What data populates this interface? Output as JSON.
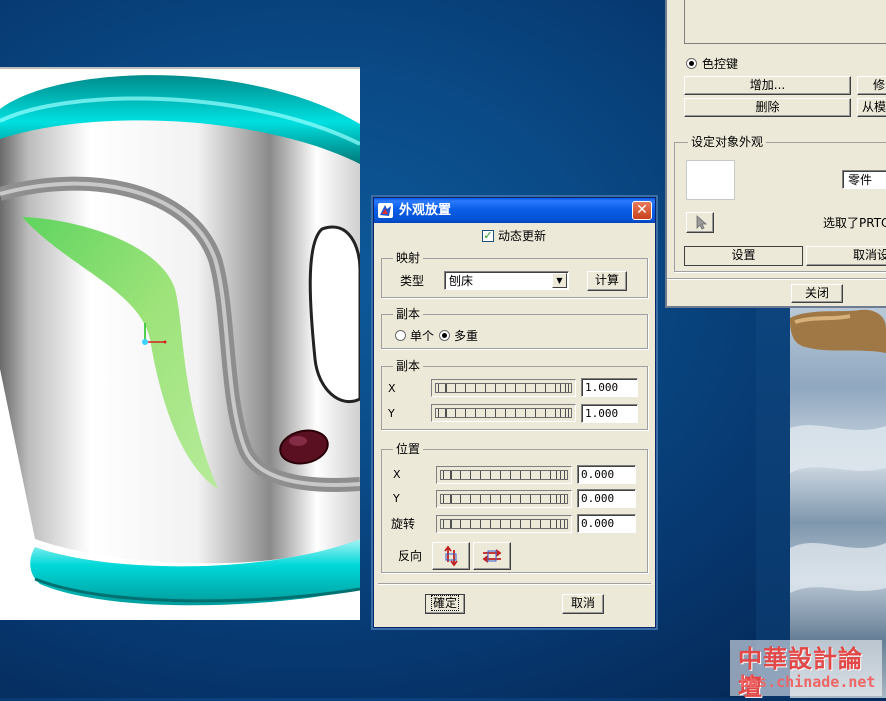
{
  "colors": {
    "desktop_bg": "#0a4a86",
    "titlebar_blue": "#0a5de8",
    "dialog_bg": "#ece9d8",
    "model_teal": "#00c8c8",
    "model_green": "#7ed957",
    "watermark_red": "#e14848"
  },
  "back_dialog": {
    "radio_color_key": "色控键",
    "button_add": "增加...",
    "button_partial_right_top": "修",
    "button_delete": "删除",
    "button_from_model": "从模",
    "group_set_appearance": "设定对象外观",
    "combo_part_value": "零件",
    "selected_text": "选取了PRTOO",
    "button_set": "设置",
    "button_cancel_set": "取消设",
    "button_close": "关闭",
    "icons": {
      "pick_arrow": "cursor-arrow-icon"
    }
  },
  "placement_dialog": {
    "title": "外观放置",
    "close_glyph": "✕",
    "dynamic_update_label": "动态更新",
    "dynamic_update_checked": true,
    "group_mapping": "映射",
    "type_label": "类型",
    "type_value": "刨床",
    "compute_button": "计算",
    "group_copy1": "副本",
    "radio_single": "单个",
    "radio_multiple": "多重",
    "radio_selected": "多重",
    "group_copy2": "副本",
    "copy_x_label": "X",
    "copy_x_value": "1.000",
    "copy_y_label": "Y",
    "copy_y_value": "1.000",
    "group_position": "位置",
    "pos_x_label": "X",
    "pos_x_value": "0.000",
    "pos_y_label": "Y",
    "pos_y_value": "0.000",
    "rotate_label": "旋转",
    "rotate_value": "0.000",
    "reverse_label": "反向",
    "ok_button": "確定",
    "cancel_button": "取消",
    "icons": {
      "app": "creo-app-icon",
      "flip_vertical": "flip-vertical-icon",
      "flip_horizontal": "flip-horizontal-icon"
    }
  },
  "watermark": {
    "title": "中華設計論壇",
    "url": "bbs.chinade.net"
  }
}
